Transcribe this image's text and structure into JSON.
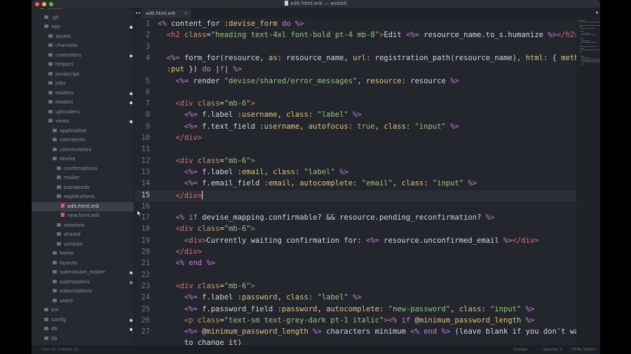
{
  "window": {
    "title": "edit.html.erb — webbit",
    "tab_label": "edit.html.erb",
    "tab_close": "×",
    "tab_nav": "◂ ▸",
    "tab_dropdown": "▾"
  },
  "sidebar": {
    "items": [
      {
        "label": "webbit",
        "indent": 0,
        "kind": "folder",
        "dot": "none",
        "selected": false
      },
      {
        "label": ".git",
        "indent": 1,
        "kind": "folder",
        "dot": "none",
        "selected": false
      },
      {
        "label": "app",
        "indent": 1,
        "kind": "folder",
        "dot": "solid",
        "selected": false
      },
      {
        "label": "assets",
        "indent": 2,
        "kind": "folder",
        "dot": "none",
        "selected": false
      },
      {
        "label": "channels",
        "indent": 2,
        "kind": "folder",
        "dot": "none",
        "selected": false
      },
      {
        "label": "controllers",
        "indent": 2,
        "kind": "folder",
        "dot": "solid",
        "selected": false
      },
      {
        "label": "helpers",
        "indent": 2,
        "kind": "folder",
        "dot": "none",
        "selected": false
      },
      {
        "label": "javascript",
        "indent": 2,
        "kind": "folder",
        "dot": "none",
        "selected": false
      },
      {
        "label": "jobs",
        "indent": 2,
        "kind": "folder",
        "dot": "none",
        "selected": false
      },
      {
        "label": "mailers",
        "indent": 2,
        "kind": "folder",
        "dot": "solid",
        "selected": false
      },
      {
        "label": "models",
        "indent": 2,
        "kind": "folder",
        "dot": "solid",
        "selected": false
      },
      {
        "label": "uploaders",
        "indent": 2,
        "kind": "folder",
        "dot": "none",
        "selected": false
      },
      {
        "label": "views",
        "indent": 2,
        "kind": "folder",
        "dot": "solid",
        "selected": false
      },
      {
        "label": "application",
        "indent": 3,
        "kind": "folder",
        "dot": "none",
        "selected": false
      },
      {
        "label": "comments",
        "indent": 3,
        "kind": "folder",
        "dot": "none",
        "selected": false
      },
      {
        "label": "communities",
        "indent": 3,
        "kind": "folder",
        "dot": "none",
        "selected": false
      },
      {
        "label": "devise",
        "indent": 3,
        "kind": "folder",
        "dot": "none",
        "selected": false
      },
      {
        "label": "confirmations",
        "indent": 4,
        "kind": "folder",
        "dot": "none",
        "selected": false
      },
      {
        "label": "mailer",
        "indent": 4,
        "kind": "folder",
        "dot": "none",
        "selected": false
      },
      {
        "label": "passwords",
        "indent": 4,
        "kind": "folder",
        "dot": "none",
        "selected": false
      },
      {
        "label": "registrations",
        "indent": 4,
        "kind": "folder",
        "dot": "none",
        "selected": false
      },
      {
        "label": "edit.html.erb",
        "indent": 5,
        "kind": "erb",
        "dot": "none",
        "selected": true
      },
      {
        "label": "new.html.erb",
        "indent": 5,
        "kind": "erb",
        "dot": "none",
        "selected": false
      },
      {
        "label": "sessions",
        "indent": 4,
        "kind": "folder",
        "dot": "none",
        "selected": false
      },
      {
        "label": "shared",
        "indent": 4,
        "kind": "folder",
        "dot": "none",
        "selected": false
      },
      {
        "label": "unlocks",
        "indent": 4,
        "kind": "folder",
        "dot": "none",
        "selected": false
      },
      {
        "label": "home",
        "indent": 3,
        "kind": "folder",
        "dot": "none",
        "selected": false
      },
      {
        "label": "layouts",
        "indent": 3,
        "kind": "folder",
        "dot": "none",
        "selected": false
      },
      {
        "label": "submission_mailer",
        "indent": 3,
        "kind": "folder",
        "dot": "solid",
        "selected": false
      },
      {
        "label": "submissions",
        "indent": 3,
        "kind": "folder",
        "dot": "hollow",
        "selected": false
      },
      {
        "label": "subscriptions",
        "indent": 3,
        "kind": "folder",
        "dot": "none",
        "selected": false
      },
      {
        "label": "users",
        "indent": 3,
        "kind": "folder",
        "dot": "none",
        "selected": false
      },
      {
        "label": "bin",
        "indent": 1,
        "kind": "folder",
        "dot": "none",
        "selected": false
      },
      {
        "label": "config",
        "indent": 1,
        "kind": "folder",
        "dot": "solid",
        "selected": false
      },
      {
        "label": "db",
        "indent": 1,
        "kind": "folder",
        "dot": "solid",
        "selected": false
      },
      {
        "label": "lib",
        "indent": 1,
        "kind": "folder",
        "dot": "none",
        "selected": false
      }
    ]
  },
  "editor": {
    "current_line": 15,
    "lines": [
      {
        "n": "1",
        "indent": 0,
        "tokens": [
          [
            "erb",
            "<%"
          ],
          [
            "txt",
            " content_for "
          ],
          [
            "sym",
            ":devise_form"
          ],
          [
            "kw",
            " do "
          ],
          [
            "erb",
            "%>"
          ]
        ]
      },
      {
        "n": "2",
        "indent": 1,
        "tokens": [
          [
            "tag",
            "<h2 "
          ],
          [
            "attr",
            "class"
          ],
          [
            "txt",
            "="
          ],
          [
            "str",
            "\"heading text-4xl font-bold pt-4 mb-8\""
          ],
          [
            "tag",
            ">"
          ],
          [
            "txt",
            "Edit "
          ],
          [
            "erb",
            "<%="
          ],
          [
            "txt",
            " resource_name.to_s.humanize "
          ],
          [
            "erb",
            "%>"
          ],
          [
            "tag",
            "</h2>"
          ]
        ]
      },
      {
        "n": "3",
        "indent": 0,
        "tokens": []
      },
      {
        "n": "4",
        "indent": 1,
        "tokens": [
          [
            "erb",
            "<%="
          ],
          [
            "txt",
            " form_for(resource, "
          ],
          [
            "sym",
            "as:"
          ],
          [
            "txt",
            " resource_name, "
          ],
          [
            "sym",
            "url:"
          ],
          [
            "txt",
            " registration_path(resource_name), "
          ],
          [
            "sym",
            "html:"
          ],
          [
            "txt",
            " { "
          ],
          [
            "sym",
            "method:"
          ]
        ]
      },
      {
        "n": "",
        "indent": 1,
        "tokens": [
          [
            "sym",
            ":put"
          ],
          [
            "txt",
            " }) "
          ],
          [
            "kw",
            "do"
          ],
          [
            "txt",
            " |"
          ],
          [
            "tag",
            "f"
          ],
          [
            "txt",
            "| "
          ],
          [
            "erb",
            "%>"
          ]
        ]
      },
      {
        "n": "5",
        "indent": 2,
        "tokens": [
          [
            "erb",
            "<%="
          ],
          [
            "txt",
            " render "
          ],
          [
            "str",
            "\"devise/shared/error_messages\""
          ],
          [
            "txt",
            ", "
          ],
          [
            "sym",
            "resource:"
          ],
          [
            "txt",
            " resource "
          ],
          [
            "erb",
            "%>"
          ]
        ]
      },
      {
        "n": "6",
        "indent": 0,
        "tokens": []
      },
      {
        "n": "7",
        "indent": 2,
        "tokens": [
          [
            "tag",
            "<div "
          ],
          [
            "attr",
            "class"
          ],
          [
            "txt",
            "="
          ],
          [
            "str",
            "\"mb-6\""
          ],
          [
            "tag",
            ">"
          ]
        ]
      },
      {
        "n": "8",
        "indent": 3,
        "tokens": [
          [
            "erb",
            "<%="
          ],
          [
            "txt",
            " f.label "
          ],
          [
            "sym",
            ":username"
          ],
          [
            "txt",
            ", "
          ],
          [
            "sym",
            "class:"
          ],
          [
            "txt",
            " "
          ],
          [
            "str",
            "\"label\""
          ],
          [
            "txt",
            " "
          ],
          [
            "erb",
            "%>"
          ]
        ]
      },
      {
        "n": "9",
        "indent": 3,
        "tokens": [
          [
            "erb",
            "<%="
          ],
          [
            "txt",
            " f.text_field "
          ],
          [
            "sym",
            ":username"
          ],
          [
            "txt",
            ", "
          ],
          [
            "sym",
            "autofocus:"
          ],
          [
            "txt",
            " "
          ],
          [
            "attr",
            "true"
          ],
          [
            "txt",
            ", "
          ],
          [
            "sym",
            "class:"
          ],
          [
            "txt",
            " "
          ],
          [
            "str",
            "\"input\""
          ],
          [
            "txt",
            " "
          ],
          [
            "erb",
            "%>"
          ]
        ]
      },
      {
        "n": "10",
        "indent": 2,
        "tokens": [
          [
            "tag",
            "</div>"
          ]
        ]
      },
      {
        "n": "11",
        "indent": 0,
        "tokens": []
      },
      {
        "n": "12",
        "indent": 2,
        "tokens": [
          [
            "tag",
            "<div "
          ],
          [
            "attr",
            "class"
          ],
          [
            "txt",
            "="
          ],
          [
            "str",
            "\"mb-6\""
          ],
          [
            "tag",
            ">"
          ]
        ]
      },
      {
        "n": "13",
        "indent": 3,
        "tokens": [
          [
            "erb",
            "<%="
          ],
          [
            "txt",
            " f.label "
          ],
          [
            "sym",
            ":email"
          ],
          [
            "txt",
            ", "
          ],
          [
            "sym",
            "class:"
          ],
          [
            "txt",
            " "
          ],
          [
            "str",
            "\"label\""
          ],
          [
            "txt",
            " "
          ],
          [
            "erb",
            "%>"
          ]
        ]
      },
      {
        "n": "14",
        "indent": 3,
        "tokens": [
          [
            "erb",
            "<%="
          ],
          [
            "txt",
            " f.email_field "
          ],
          [
            "sym",
            ":email"
          ],
          [
            "txt",
            ", "
          ],
          [
            "sym",
            "autocomplete:"
          ],
          [
            "txt",
            " "
          ],
          [
            "str",
            "\"email\""
          ],
          [
            "txt",
            ", "
          ],
          [
            "sym",
            "class:"
          ],
          [
            "txt",
            " "
          ],
          [
            "str",
            "\"input\""
          ],
          [
            "txt",
            " "
          ],
          [
            "erb",
            "%>"
          ]
        ]
      },
      {
        "n": "15",
        "indent": 2,
        "tokens": [
          [
            "tag",
            "</div>"
          ]
        ],
        "cursor": true
      },
      {
        "n": "16",
        "indent": 0,
        "tokens": []
      },
      {
        "n": "17",
        "indent": 2,
        "tokens": [
          [
            "erb",
            "<%"
          ],
          [
            "kw",
            " if"
          ],
          [
            "txt",
            " devise_mapping.confirmable? && resource.pending_reconfirmation? "
          ],
          [
            "erb",
            "%>"
          ]
        ]
      },
      {
        "n": "18",
        "indent": 2,
        "tokens": [
          [
            "tag",
            "<div "
          ],
          [
            "attr",
            "class"
          ],
          [
            "txt",
            "="
          ],
          [
            "str",
            "\"mb-6\""
          ],
          [
            "tag",
            ">"
          ]
        ]
      },
      {
        "n": "19",
        "indent": 3,
        "tokens": [
          [
            "tag",
            "<div>"
          ],
          [
            "txt",
            "Currently waiting confirmation for: "
          ],
          [
            "erb",
            "<%="
          ],
          [
            "txt",
            " resource.unconfirmed_email "
          ],
          [
            "erb",
            "%>"
          ],
          [
            "tag",
            "</div>"
          ]
        ]
      },
      {
        "n": "20",
        "indent": 2,
        "tokens": [
          [
            "tag",
            "</div>"
          ]
        ]
      },
      {
        "n": "21",
        "indent": 2,
        "tokens": [
          [
            "erb",
            "<%"
          ],
          [
            "kw",
            " end "
          ],
          [
            "erb",
            "%>"
          ]
        ]
      },
      {
        "n": "22",
        "indent": 0,
        "tokens": []
      },
      {
        "n": "23",
        "indent": 2,
        "tokens": [
          [
            "tag",
            "<div "
          ],
          [
            "attr",
            "class"
          ],
          [
            "txt",
            "="
          ],
          [
            "str",
            "\"mb-6\""
          ],
          [
            "tag",
            ">"
          ]
        ]
      },
      {
        "n": "24",
        "indent": 3,
        "tokens": [
          [
            "erb",
            "<%="
          ],
          [
            "txt",
            " f.label "
          ],
          [
            "sym",
            ":password"
          ],
          [
            "txt",
            ", "
          ],
          [
            "sym",
            "class:"
          ],
          [
            "txt",
            " "
          ],
          [
            "str",
            "\"label\""
          ],
          [
            "txt",
            " "
          ],
          [
            "erb",
            "%>"
          ]
        ]
      },
      {
        "n": "25",
        "indent": 3,
        "tokens": [
          [
            "erb",
            "<%="
          ],
          [
            "txt",
            " f.password_field "
          ],
          [
            "sym",
            ":password"
          ],
          [
            "txt",
            ", "
          ],
          [
            "sym",
            "autocomplete:"
          ],
          [
            "txt",
            " "
          ],
          [
            "str",
            "\"new-password\""
          ],
          [
            "txt",
            ", "
          ],
          [
            "sym",
            "class:"
          ],
          [
            "txt",
            " "
          ],
          [
            "str",
            "\"input\""
          ],
          [
            "txt",
            " "
          ],
          [
            "erb",
            "%>"
          ]
        ]
      },
      {
        "n": "26",
        "indent": 3,
        "tokens": [
          [
            "tag",
            "<p "
          ],
          [
            "attr",
            "class"
          ],
          [
            "txt",
            "="
          ],
          [
            "str",
            "\"text-sm text-grey-dark pt-1 italic\""
          ],
          [
            "tag",
            ">"
          ],
          [
            "erb",
            "<%"
          ],
          [
            "kw",
            " if"
          ],
          [
            "txt",
            " @"
          ],
          [
            "sym",
            "minimum_password_length"
          ],
          [
            "txt",
            " "
          ],
          [
            "erb",
            "%>"
          ]
        ]
      },
      {
        "n": "27",
        "indent": 3,
        "tokens": [
          [
            "erb",
            "<%="
          ],
          [
            "txt",
            " @"
          ],
          [
            "sym",
            "minimum_password_length"
          ],
          [
            "txt",
            " "
          ],
          [
            "erb",
            "%>"
          ],
          [
            "txt",
            " characters minimum "
          ],
          [
            "erb",
            "<%"
          ],
          [
            "kw",
            " end "
          ],
          [
            "erb",
            "%>"
          ],
          [
            "txt",
            " (leave blank if you don't want"
          ]
        ]
      },
      {
        "n": "",
        "indent": 3,
        "tokens": [
          [
            "txt",
            "to change it)"
          ]
        ]
      }
    ]
  },
  "status": {
    "position": "Line 15, Column 11",
    "branch": "master",
    "spaces": "Spaces: 2",
    "syntax": "HTML (Rails)"
  }
}
